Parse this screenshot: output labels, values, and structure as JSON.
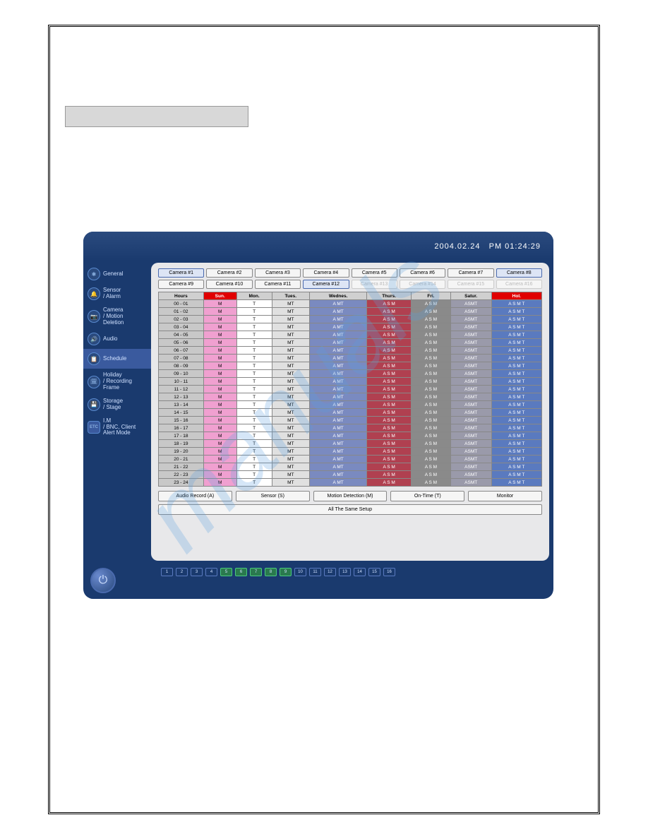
{
  "header": {
    "date": "2004.02.24",
    "time": "PM 01:24:29"
  },
  "sidebar": {
    "items": [
      {
        "label": "General",
        "icon": "✱"
      },
      {
        "label": "Sensor\n/ Alarm",
        "icon": "🔔"
      },
      {
        "label": "Camera\n/ Motion\nDeletion",
        "icon": "📷"
      },
      {
        "label": "Audio",
        "icon": "🔊"
      },
      {
        "label": "Schedule",
        "icon": "📋",
        "active": true
      },
      {
        "label": "Holiday\n/ Recording\nFrame",
        "icon": "🗓"
      },
      {
        "label": "Storage\n/ Stage",
        "icon": "💾"
      },
      {
        "label": "I.M\n/ BNC, Client\nAlert Mode",
        "icon": "ETC"
      }
    ]
  },
  "cameras": {
    "row1": [
      {
        "label": "Camera #1",
        "state": "active"
      },
      {
        "label": "Camera #2",
        "state": "normal"
      },
      {
        "label": "Camera #3",
        "state": "normal"
      },
      {
        "label": "Camera #4",
        "state": "normal"
      },
      {
        "label": "Camera #5",
        "state": "normal"
      },
      {
        "label": "Camera #6",
        "state": "normal"
      },
      {
        "label": "Camera #7",
        "state": "normal"
      },
      {
        "label": "Camera #8",
        "state": "active"
      }
    ],
    "row2": [
      {
        "label": "Camera #9",
        "state": "normal"
      },
      {
        "label": "Camera #10",
        "state": "normal"
      },
      {
        "label": "Camera #11",
        "state": "normal"
      },
      {
        "label": "Camera #12",
        "state": "active"
      },
      {
        "label": "Camera #13",
        "state": "disabled"
      },
      {
        "label": "Camera #14",
        "state": "disabled"
      },
      {
        "label": "Camera #15",
        "state": "disabled"
      },
      {
        "label": "Camera #16",
        "state": "disabled"
      }
    ]
  },
  "schedule": {
    "headers": [
      "Hours",
      "Sun.",
      "Mon.",
      "Tues.",
      "Wednes.",
      "Thurs.",
      "Fri.",
      "Satur.",
      "Hol."
    ],
    "rows": [
      {
        "hour": "00 - 01",
        "cells": [
          "M",
          "T",
          "MT",
          "A  MT",
          "A S M",
          "A S M",
          "ASMT",
          "A S M T"
        ]
      },
      {
        "hour": "01 - 02",
        "cells": [
          "M",
          "T",
          "MT",
          "A  MT",
          "A S M",
          "A S M",
          "ASMT",
          "A S M T"
        ]
      },
      {
        "hour": "02 - 03",
        "cells": [
          "M",
          "T",
          "MT",
          "A  MT",
          "A S M",
          "A S M",
          "ASMT",
          "A S M T"
        ]
      },
      {
        "hour": "03 - 04",
        "cells": [
          "M",
          "T",
          "MT",
          "A  MT",
          "A S M",
          "A S M",
          "ASMT",
          "A S M T"
        ]
      },
      {
        "hour": "04 - 05",
        "cells": [
          "M",
          "T",
          "MT",
          "A  MT",
          "A S M",
          "A S M",
          "ASMT",
          "A S M T"
        ]
      },
      {
        "hour": "05 - 06",
        "cells": [
          "M",
          "T",
          "MT",
          "A  MT",
          "A S M",
          "A S M",
          "ASMT",
          "A S M T"
        ]
      },
      {
        "hour": "06 - 07",
        "cells": [
          "M",
          "T",
          "MT",
          "A  MT",
          "A S M",
          "A S M",
          "ASMT",
          "A S M T"
        ]
      },
      {
        "hour": "07 - 08",
        "cells": [
          "M",
          "T",
          "MT",
          "A  MT",
          "A S M",
          "A S M",
          "ASMT",
          "A S M T"
        ]
      },
      {
        "hour": "08 - 09",
        "cells": [
          "M",
          "T",
          "MT",
          "A  MT",
          "A S M",
          "A S M",
          "ASMT",
          "A S M T"
        ]
      },
      {
        "hour": "09 - 10",
        "cells": [
          "M",
          "T",
          "MT",
          "A  MT",
          "A S M",
          "A S M",
          "ASMT",
          "A S M T"
        ]
      },
      {
        "hour": "10 - 11",
        "cells": [
          "M",
          "T",
          "MT",
          "A  MT",
          "A S M",
          "A S M",
          "ASMT",
          "A S M T"
        ]
      },
      {
        "hour": "11 - 12",
        "cells": [
          "M",
          "T",
          "MT",
          "A  MT",
          "A S M",
          "A S M",
          "ASMT",
          "A S M T"
        ]
      },
      {
        "hour": "12 - 13",
        "cells": [
          "M",
          "T",
          "MT",
          "A  MT",
          "A S M",
          "A S M",
          "ASMT",
          "A S M T"
        ]
      },
      {
        "hour": "13 - 14",
        "cells": [
          "M",
          "T",
          "MT",
          "A  MT",
          "A S M",
          "A S M",
          "ASMT",
          "A S M T"
        ]
      },
      {
        "hour": "14 - 15",
        "cells": [
          "M",
          "T",
          "MT",
          "A  MT",
          "A S M",
          "A S M",
          "ASMT",
          "A S M T"
        ]
      },
      {
        "hour": "15 - 16",
        "cells": [
          "M",
          "T",
          "MT",
          "A  MT",
          "A S M",
          "A S M",
          "ASMT",
          "A S M T"
        ]
      },
      {
        "hour": "16 - 17",
        "cells": [
          "M",
          "T",
          "MT",
          "A  MT",
          "A S M",
          "A S M",
          "ASMT",
          "A S M T"
        ]
      },
      {
        "hour": "17 - 18",
        "cells": [
          "M",
          "T",
          "MT",
          "A  MT",
          "A S M",
          "A S M",
          "ASMT",
          "A S M T"
        ]
      },
      {
        "hour": "18 - 19",
        "cells": [
          "M",
          "T",
          "MT",
          "A  MT",
          "A S M",
          "A S M",
          "ASMT",
          "A S M T"
        ]
      },
      {
        "hour": "19 - 20",
        "cells": [
          "M",
          "T",
          "MT",
          "A  MT",
          "A S M",
          "A S M",
          "ASMT",
          "A S M T"
        ]
      },
      {
        "hour": "20 - 21",
        "cells": [
          "M",
          "T",
          "MT",
          "A  MT",
          "A S M",
          "A S M",
          "ASMT",
          "A S M T"
        ]
      },
      {
        "hour": "21 - 22",
        "cells": [
          "M",
          "T",
          "MT",
          "A  MT",
          "A S M",
          "A S M",
          "ASMT",
          "A S M T"
        ]
      },
      {
        "hour": "22 - 23",
        "cells": [
          "M",
          "T",
          "MT",
          "A  MT",
          "A S M",
          "A S M",
          "ASMT",
          "A S M T"
        ]
      },
      {
        "hour": "23 - 24",
        "cells": [
          "M",
          "T",
          "MT",
          "A  MT",
          "A S M",
          "A S M",
          "ASMT",
          "A S M T"
        ]
      }
    ]
  },
  "modes": {
    "audio": "Audio Record (A)",
    "sensor": "Sensor (S)",
    "motion": "Motion Detection (M)",
    "ontime": "On-Time (T)",
    "monitor": "Monitor",
    "all_same": "All The Same Setup"
  },
  "channels": [
    {
      "n": "1",
      "on": false
    },
    {
      "n": "2",
      "on": false
    },
    {
      "n": "3",
      "on": false
    },
    {
      "n": "4",
      "on": false
    },
    {
      "n": "5",
      "on": true
    },
    {
      "n": "6",
      "on": true
    },
    {
      "n": "7",
      "on": true
    },
    {
      "n": "8",
      "on": true
    },
    {
      "n": "9",
      "on": true
    },
    {
      "n": "10",
      "on": false
    },
    {
      "n": "11",
      "on": false
    },
    {
      "n": "12",
      "on": false
    },
    {
      "n": "13",
      "on": false
    },
    {
      "n": "14",
      "on": false
    },
    {
      "n": "15",
      "on": false
    },
    {
      "n": "16",
      "on": false
    }
  ]
}
